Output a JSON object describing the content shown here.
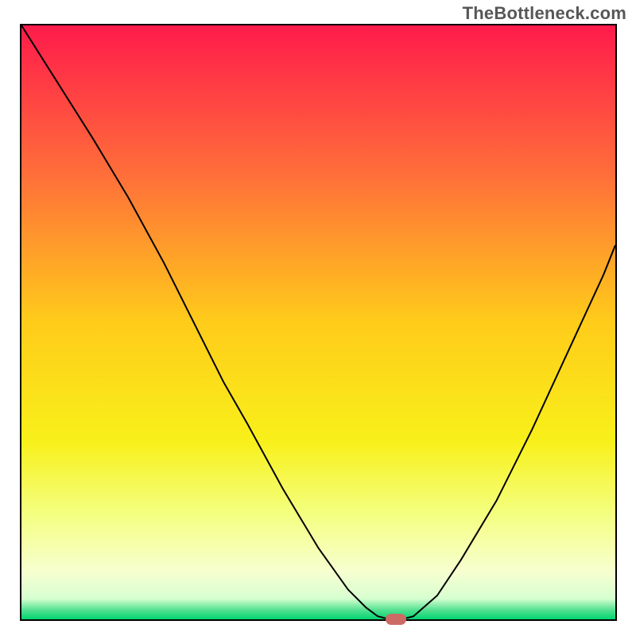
{
  "watermark": "TheBottleneck.com",
  "chart_data": {
    "type": "line",
    "title": "",
    "xlabel": "",
    "ylabel": "",
    "xlim": [
      0,
      100
    ],
    "ylim": [
      0,
      100
    ],
    "grid": false,
    "legend": false,
    "gradient_stops": [
      {
        "offset": 0.0,
        "color": "#ff1b4b"
      },
      {
        "offset": 0.25,
        "color": "#ff6e3a"
      },
      {
        "offset": 0.5,
        "color": "#ffcc1a"
      },
      {
        "offset": 0.7,
        "color": "#f8f01a"
      },
      {
        "offset": 0.82,
        "color": "#f4ff7e"
      },
      {
        "offset": 0.92,
        "color": "#f7ffd0"
      },
      {
        "offset": 0.965,
        "color": "#d7ffd0"
      },
      {
        "offset": 0.985,
        "color": "#50e090"
      },
      {
        "offset": 1.0,
        "color": "#00d670"
      }
    ],
    "series": [
      {
        "name": "bottleneck-curve",
        "x": [
          0,
          6,
          12,
          18,
          24,
          30,
          34,
          38,
          44,
          50,
          55,
          58,
          60,
          62,
          64,
          66,
          70,
          74,
          80,
          86,
          92,
          98,
          100
        ],
        "y": [
          100,
          90.5,
          81,
          71,
          60,
          48,
          40,
          33,
          22,
          12,
          5,
          2,
          0.5,
          0,
          0,
          0.5,
          4,
          10,
          20,
          32,
          45,
          58,
          63
        ]
      }
    ],
    "marker": {
      "x": 63,
      "y": 0,
      "color": "#cc6b66"
    }
  }
}
